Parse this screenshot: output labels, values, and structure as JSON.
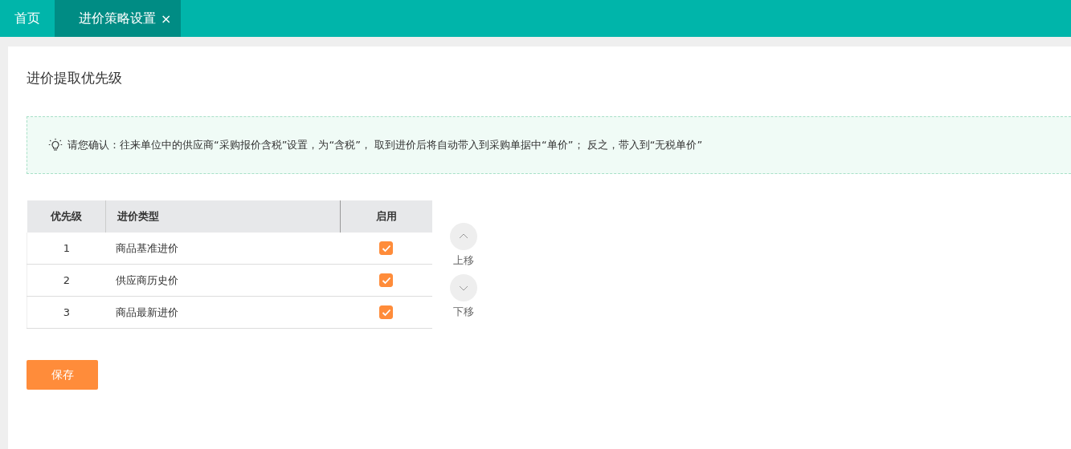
{
  "tabs": [
    {
      "label": "首页",
      "selected": false,
      "closable": false
    },
    {
      "label": "进价策略设置",
      "selected": true,
      "closable": true,
      "close_glyph": "×"
    }
  ],
  "title": "进价提取优先级",
  "notice": "请您确认：往来单位中的供应商“采购报价含税”设置，为“含税”， 取到进价后将自动带入到采购单据中“单价”； 反之，带入到“无税单价”",
  "table": {
    "columns": [
      "优先级",
      "进价类型",
      "启用"
    ],
    "rows": [
      {
        "priority": "1",
        "type": "商品基准进价",
        "enabled": true
      },
      {
        "priority": "2",
        "type": "供应商历史价",
        "enabled": true
      },
      {
        "priority": "3",
        "type": "商品最新进价",
        "enabled": true
      }
    ]
  },
  "move_up": "上移",
  "move_down": "下移",
  "save_button": "保存"
}
